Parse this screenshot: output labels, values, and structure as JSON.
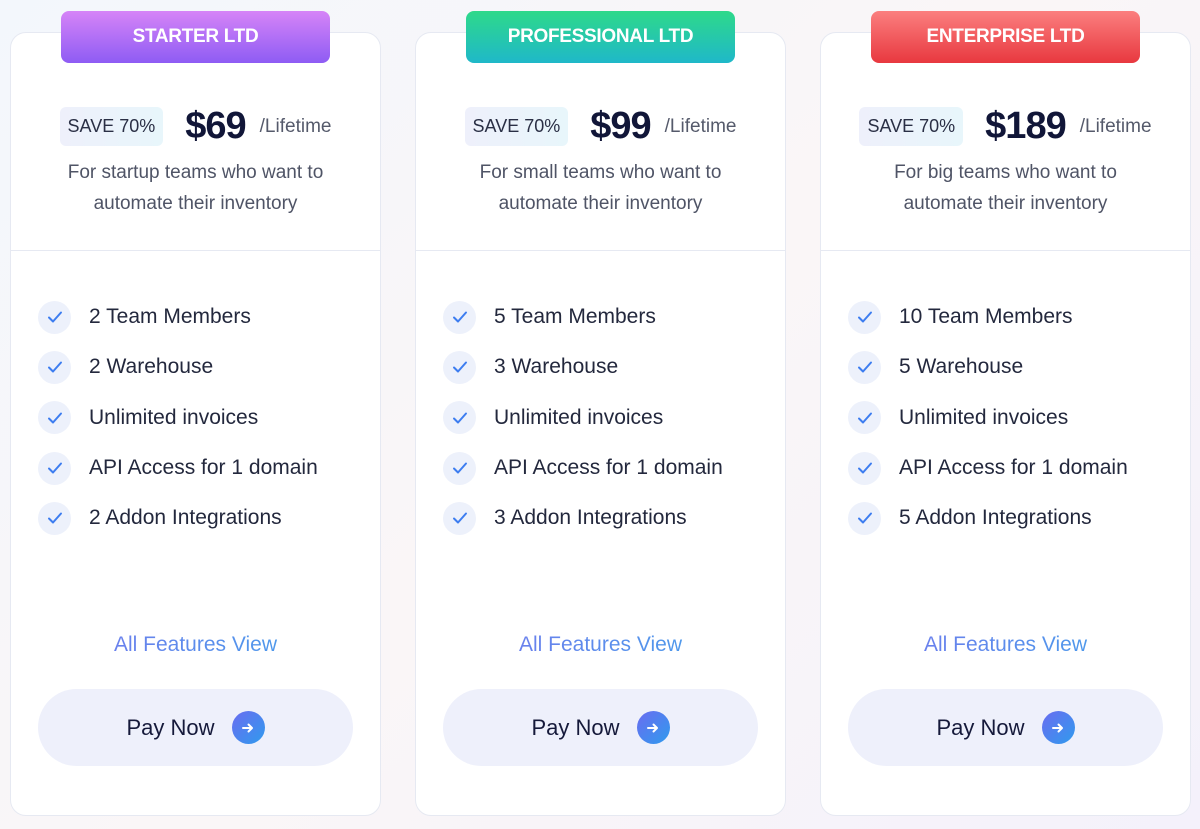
{
  "plans": [
    {
      "name": "STARTER LTD",
      "save": "SAVE 70%",
      "price": "$69",
      "period": "/Lifetime",
      "desc1": "For startup teams who want to",
      "desc2": "automate their inventory",
      "features": [
        "2 Team Members",
        "2 Warehouse",
        "Unlimited invoices",
        "API Access for 1 domain",
        "2 Addon Integrations"
      ],
      "link": "All Features View",
      "button": "Pay Now",
      "gradient": [
        "#d684f7",
        "#8e5cf4"
      ]
    },
    {
      "name": "PROFESSIONAL LTD",
      "save": "SAVE 70%",
      "price": "$99",
      "period": "/Lifetime",
      "desc1": "For small teams who want to",
      "desc2": "automate their inventory",
      "features": [
        "5 Team Members",
        "3 Warehouse",
        "Unlimited invoices",
        "API Access for 1 domain",
        "3 Addon Integrations"
      ],
      "link": "All Features View",
      "button": "Pay Now",
      "gradient": [
        "#2ed98a",
        "#1fb8c9"
      ]
    },
    {
      "name": "ENTERPRISE LTD",
      "save": "SAVE 70%",
      "price": "$189",
      "period": "/Lifetime",
      "desc1": "For big teams who want to",
      "desc2": "automate their inventory",
      "features": [
        "10 Team Members",
        "5 Warehouse",
        "Unlimited invoices",
        "API Access for 1 domain",
        "5 Addon Integrations"
      ],
      "link": "All Features View",
      "button": "Pay Now",
      "gradient": [
        "#fb7f7f",
        "#e8383f"
      ]
    }
  ],
  "icons": {
    "feature": "check-icon",
    "button": "arrow-right-icon"
  }
}
